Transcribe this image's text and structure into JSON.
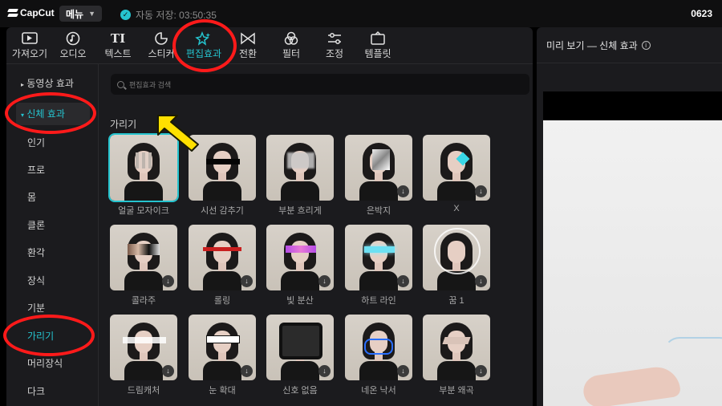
{
  "app": {
    "logo": "CapCut",
    "menu_label": "메뉴",
    "autosave": "자동 저장: 03:50:35",
    "project_name": "0623"
  },
  "toolbar": {
    "tabs": [
      {
        "label": "가져오기",
        "icon": "import-icon"
      },
      {
        "label": "오디오",
        "icon": "audio-icon"
      },
      {
        "label": "텍스트",
        "icon": "text-icon"
      },
      {
        "label": "스티커",
        "icon": "sticker-icon"
      },
      {
        "label": "편집효과",
        "icon": "effects-icon",
        "active": true
      },
      {
        "label": "전환",
        "icon": "transition-icon"
      },
      {
        "label": "필터",
        "icon": "filter-icon"
      },
      {
        "label": "조정",
        "icon": "adjust-icon"
      },
      {
        "label": "템플릿",
        "icon": "template-icon"
      }
    ]
  },
  "sidebar": {
    "items": [
      {
        "label": "동영상 효과",
        "type": "group"
      },
      {
        "label": "신체 효과",
        "type": "group-active"
      },
      {
        "label": "인기"
      },
      {
        "label": "프로"
      },
      {
        "label": "몸"
      },
      {
        "label": "클론"
      },
      {
        "label": "환각"
      },
      {
        "label": "장식"
      },
      {
        "label": "기분"
      },
      {
        "label": "가리기",
        "highlight": true
      },
      {
        "label": "머리장식"
      },
      {
        "label": "다크"
      }
    ]
  },
  "search": {
    "placeholder": "편집효과 검색"
  },
  "section": {
    "title": "가리기"
  },
  "effects": [
    {
      "label": "얼굴 모자이크",
      "selected": true,
      "download": false
    },
    {
      "label": "시선 감추기",
      "download": false
    },
    {
      "label": "부분 흐리게",
      "download": false
    },
    {
      "label": "은박지",
      "download": true
    },
    {
      "label": "X",
      "download": true
    },
    {
      "label": "콜라주",
      "download": true
    },
    {
      "label": "롤링",
      "download": true
    },
    {
      "label": "빛 분산",
      "download": true
    },
    {
      "label": "하트 라인",
      "download": true
    },
    {
      "label": "꿈 1",
      "download": true
    },
    {
      "label": "드림캐처",
      "download": true
    },
    {
      "label": "눈 확대",
      "download": true
    },
    {
      "label": "신호 없음",
      "download": true
    },
    {
      "label": "네온 낙서",
      "download": true
    },
    {
      "label": "부분 왜곡",
      "download": true
    }
  ],
  "preview": {
    "title": "미리 보기 — 신체 효과"
  },
  "colors": {
    "accent": "#25c4cf",
    "annotation": "#ff1a1a",
    "arrow": "#ffe000"
  }
}
